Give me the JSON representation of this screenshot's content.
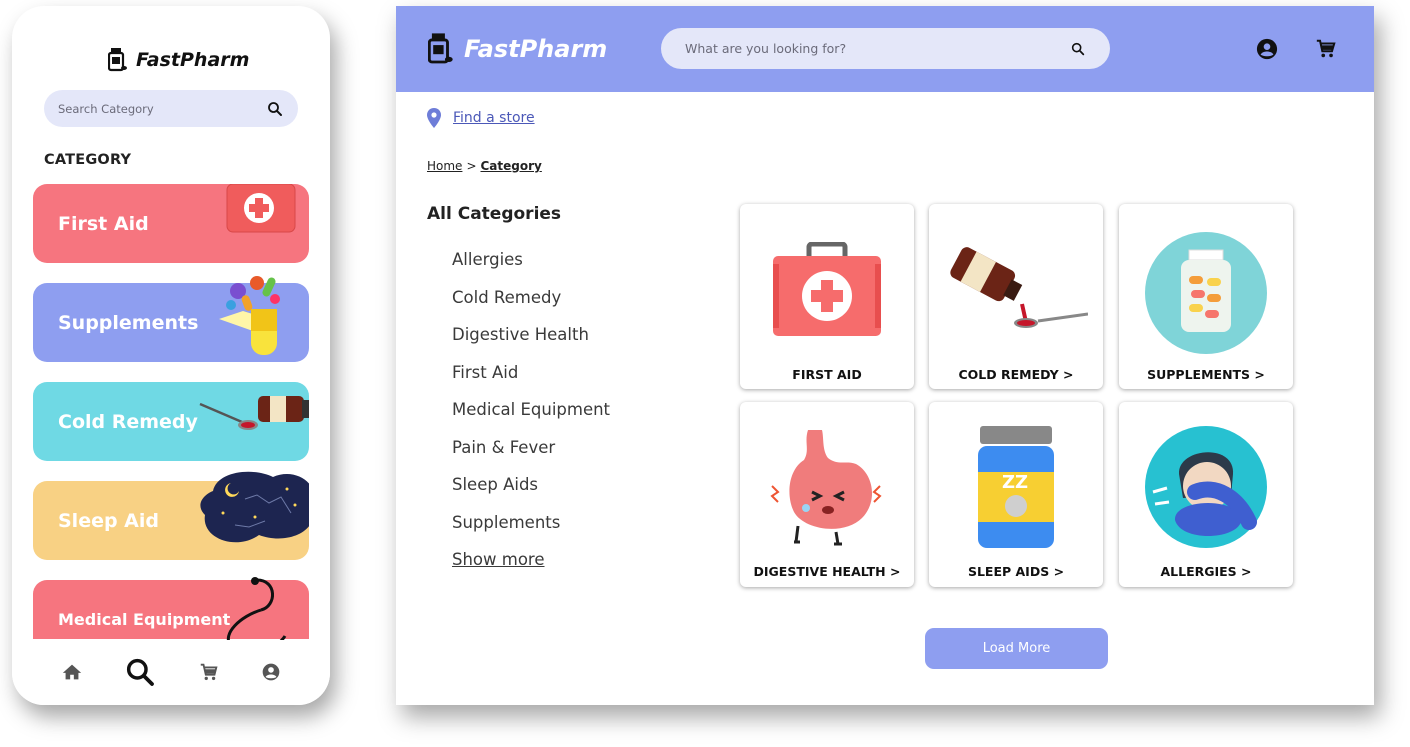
{
  "mobile": {
    "logo_text": "FastPharm",
    "search_placeholder": "Search Category",
    "category_heading": "CATEGORY",
    "cards": [
      {
        "label": "First Aid",
        "color": "#f6757f",
        "icon": "first-aid-kit-icon"
      },
      {
        "label": "Supplements",
        "color": "#8e9ef0",
        "icon": "supplements-icon"
      },
      {
        "label": "Cold Remedy",
        "color": "#6fd9e4",
        "icon": "syrup-spoon-icon"
      },
      {
        "label": "Sleep Aid",
        "color": "#f8d184",
        "icon": "night-sky-icon"
      },
      {
        "label": "Medical Equipment",
        "color": "#f6757f",
        "icon": "stethoscope-icon"
      }
    ],
    "nav": [
      "home-icon",
      "search-icon",
      "cart-icon",
      "account-icon"
    ]
  },
  "desktop": {
    "logo_text": "FastPharm",
    "search_placeholder": "What are you looking for?",
    "find_store": "Find a store",
    "breadcrumb": {
      "home": "Home",
      "separator": ">",
      "current": "Category"
    },
    "all_categories_heading": "All Categories",
    "categories": [
      "Allergies",
      "Cold Remedy",
      "Digestive Health",
      "First Aid",
      "Medical Equipment",
      "Pain & Fever",
      "Sleep Aids",
      "Supplements"
    ],
    "show_more": "Show more",
    "tiles": [
      {
        "label": "FIRST AID",
        "icon": "first-aid-kit-icon"
      },
      {
        "label": "COLD REMEDY >",
        "icon": "syrup-spoon-icon"
      },
      {
        "label": "SUPPLEMENTS >",
        "icon": "supplements-jar-icon"
      },
      {
        "label": "DIGESTIVE HEALTH >",
        "icon": "stomach-icon"
      },
      {
        "label": "SLEEP AIDS >",
        "icon": "sleep-aid-bottle-icon"
      },
      {
        "label": "ALLERGIES >",
        "icon": "sneezing-person-icon"
      }
    ],
    "load_more": "Load More"
  },
  "colors": {
    "brand": "#8e9ef0",
    "search_bg": "#e4e7f9",
    "red": "#f6757f",
    "cyan": "#6fd9e4",
    "yellow": "#f8d184"
  }
}
